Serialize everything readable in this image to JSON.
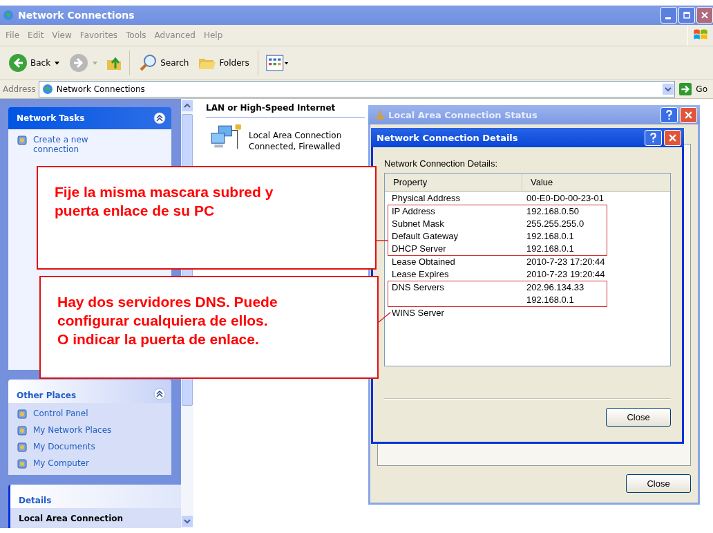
{
  "window": {
    "title": "Network Connections"
  },
  "menu": [
    "File",
    "Edit",
    "View",
    "Favorites",
    "Tools",
    "Advanced",
    "Help"
  ],
  "toolbar": {
    "back": "Back",
    "search": "Search",
    "folders": "Folders"
  },
  "address": {
    "label": "Address",
    "value": "Network Connections",
    "go": "Go"
  },
  "sidebar": {
    "panels": [
      {
        "kind": "primary",
        "title": "Network Tasks",
        "items": [
          "Create a new connection"
        ]
      },
      {
        "kind": "plain",
        "title": "Other Places",
        "items": [
          "Control Panel",
          "My Network Places",
          "My Documents",
          "My Computer"
        ]
      },
      {
        "kind": "details",
        "title": "Details",
        "items": [
          "Local Area Connection"
        ]
      }
    ]
  },
  "content": {
    "group": "LAN or High-Speed Internet",
    "items": [
      {
        "name": "Local Area Connection",
        "status": "Connected, Firewalled"
      }
    ]
  },
  "status_dialog": {
    "title": "Local Area Connection Status",
    "close": "Close"
  },
  "details_dialog": {
    "title": "Network Connection Details",
    "label": "Network Connection Details:",
    "columns": [
      "Property",
      "Value"
    ],
    "close": "Close",
    "rows": [
      {
        "property": "Physical Address",
        "values": [
          "00-E0-D0-00-23-01"
        ],
        "boxed": false
      },
      {
        "property": "IP Address",
        "values": [
          "192.168.0.50"
        ],
        "boxed": true
      },
      {
        "property": "Subnet Mask",
        "values": [
          "255.255.255.0"
        ],
        "boxed": true
      },
      {
        "property": "Default Gateway",
        "values": [
          "192.168.0.1"
        ],
        "boxed": true
      },
      {
        "property": "DHCP Server",
        "values": [
          "192.168.0.1"
        ],
        "boxed": true
      },
      {
        "property": "Lease Obtained",
        "values": [
          "2010-7-23 17:20:44"
        ],
        "boxed": false
      },
      {
        "property": "Lease Expires",
        "values": [
          "2010-7-23 19:20:44"
        ],
        "boxed": false
      },
      {
        "property": "DNS Servers",
        "values": [
          "202.96.134.33",
          "192.168.0.1"
        ],
        "boxed": true
      },
      {
        "property": "WINS Server",
        "values": [],
        "boxed": false
      }
    ]
  },
  "callouts": [
    {
      "lines": [
        "Fije la misma mascara subred y",
        "puerta enlace de su PC"
      ]
    },
    {
      "lines": [
        "Hay dos servidores DNS. Puede",
        "configurar cualquiera de ellos.",
        "O indicar la puerta de enlace."
      ]
    }
  ]
}
